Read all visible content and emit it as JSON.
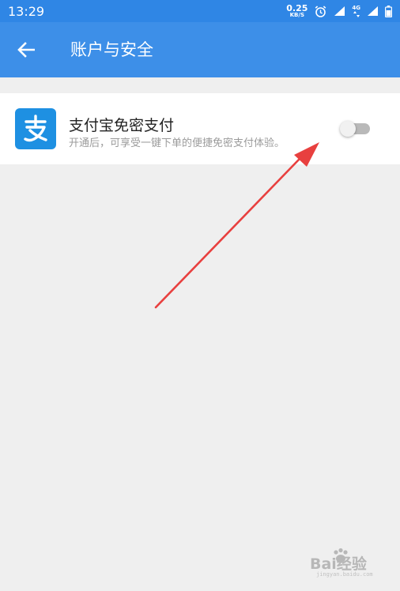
{
  "status_bar": {
    "time": "13:29",
    "net_speed_value": "0.25",
    "net_speed_unit": "KB/S",
    "network_type": "4G",
    "icons": [
      "alarm-icon",
      "signal-icon",
      "data-arrows-icon",
      "battery-icon"
    ]
  },
  "header": {
    "title": "账户与安全",
    "back_icon": "arrow-left-icon",
    "background_color": "#3d8fe8"
  },
  "setting": {
    "icon_glyph": "支",
    "icon_color": "#1e90e2",
    "title": "支付宝免密支付",
    "description": "开通后，可享受一键下单的便捷免密支付体验。",
    "toggle_on": false
  },
  "annotation": {
    "type": "red-arrow",
    "color": "#e8403f"
  },
  "watermark": {
    "text": "Bai经验",
    "sub": "jingyan.baidu.com"
  }
}
